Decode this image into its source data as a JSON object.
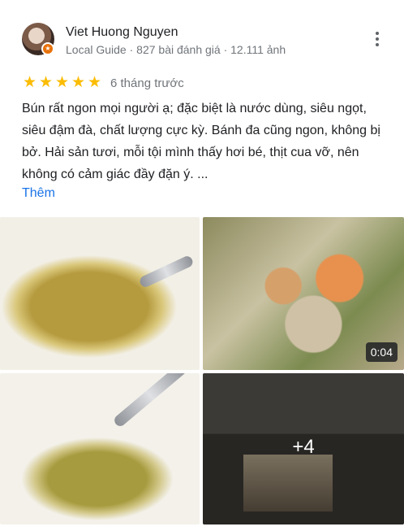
{
  "reviewer": {
    "name": "Viet Huong Nguyen",
    "meta": "Local Guide · 827 bài đánh giá · 12.111 ảnh"
  },
  "rating": {
    "stars": 5,
    "time_ago": "6 tháng trước"
  },
  "review": {
    "text": "Bún rất ngon mọi người ạ; đặc biệt là nước dùng, siêu ngọt, siêu đậm đà, chất lượng cực kỳ. Bánh đa cũng ngon, không bị bở. Hải sản tươi, mỗi tội mình thấy hơi bé, thịt cua vỡ, nên không có cảm giác đầy đặn ý. ...",
    "more_label": "Thêm"
  },
  "photos": {
    "video_duration": "0:04",
    "more_count": "+4"
  },
  "colors": {
    "star": "#fbbc04",
    "link": "#1a73e8",
    "secondary_text": "#70757a",
    "local_guide_badge": "#e8710a"
  },
  "icons": [
    "star-icon",
    "more-vert-icon",
    "local-guide-badge-icon"
  ]
}
